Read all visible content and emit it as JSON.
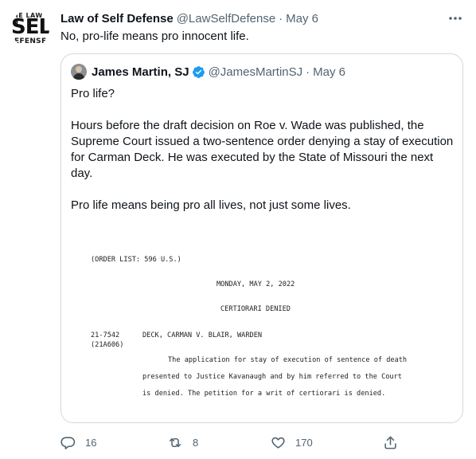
{
  "tweet": {
    "avatar": {
      "line1": "HE LAW O",
      "line2": "SELF",
      "line3": "EFENSE"
    },
    "author_name": "Law of Self Defense",
    "author_handle": "@LawSelfDefense",
    "separator": "·",
    "date": "May 6",
    "text": "No, pro-life means pro innocent life."
  },
  "quote": {
    "author_name": "James Martin, SJ",
    "author_handle": "@JamesMartinSJ",
    "separator": "·",
    "date": "May 6",
    "paragraphs": [
      "Pro life?",
      "Hours before the draft decision on Roe v. Wade was published, the Supreme Court issued a two-sentence order denying a stay of execution for Carman Deck. He was executed by the State of Missouri the next day.",
      "Pro life means being pro all lives, not just some lives."
    ],
    "document": {
      "order_list": "(ORDER LIST:  596 U.S.)",
      "date_line": "MONDAY, MAY 2, 2022",
      "heading": "CERTIORARI DENIED",
      "case_number": "21-7542",
      "application_number": "(21A606)",
      "case_name": "DECK, CARMAN V. BLAIR, WARDEN",
      "body_line1": "The application for stay of execution of sentence of death",
      "body_line2": "presented to Justice Kavanaugh and by him referred to the Court",
      "body_line3": "is denied.  The petition for a writ of certiorari is denied."
    }
  },
  "actions": {
    "replies": "16",
    "retweets": "8",
    "likes": "170"
  },
  "colors": {
    "text": "#0f1419",
    "secondary": "#536471",
    "border": "#cfd9de",
    "verified": "#1d9bf0"
  },
  "icons": [
    "more-icon",
    "verified-badge-icon",
    "reply-icon",
    "retweet-icon",
    "like-icon",
    "share-icon"
  ]
}
